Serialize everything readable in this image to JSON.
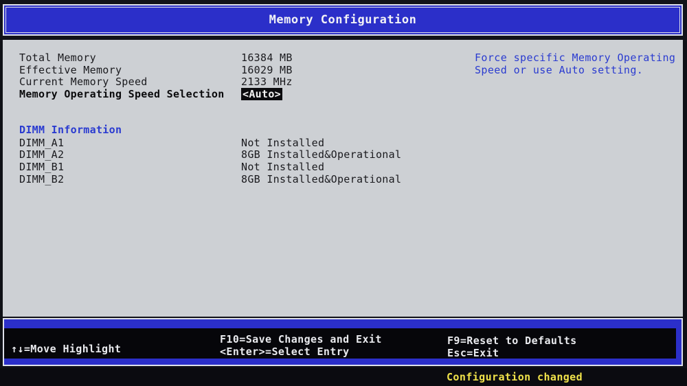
{
  "header": {
    "title": "Memory Configuration"
  },
  "memory": [
    {
      "label": "Total Memory",
      "value": "16384 MB"
    },
    {
      "label": "Effective Memory",
      "value": "16029 MB"
    },
    {
      "label": "Current Memory Speed",
      "value": "2133 MHz"
    }
  ],
  "speed_selection": {
    "label": "Memory Operating Speed Selection",
    "value": "<Auto>"
  },
  "dimm": {
    "heading": "DIMM Information",
    "slots": [
      {
        "label": "DIMM_A1",
        "value": "Not Installed"
      },
      {
        "label": "DIMM_A2",
        "value": "8GB Installed&Operational"
      },
      {
        "label": "DIMM_B1",
        "value": "Not Installed"
      },
      {
        "label": "DIMM_B2",
        "value": "8GB Installed&Operational"
      }
    ]
  },
  "help": {
    "text": "Force specific Memory Operating Speed or use Auto setting."
  },
  "footer": {
    "move": "↑↓=Move Highlight",
    "save": "F10=Save Changes and Exit",
    "select": "<Enter>=Select Entry",
    "reset": "F9=Reset to Defaults",
    "exit": "Esc=Exit"
  },
  "status": {
    "text": "Configuration changed"
  },
  "colors": {
    "header_bg": "#2b2fc9",
    "main_bg": "#cdd0d4",
    "help_text": "#2a3bd0",
    "status_text": "#f0e24a"
  }
}
